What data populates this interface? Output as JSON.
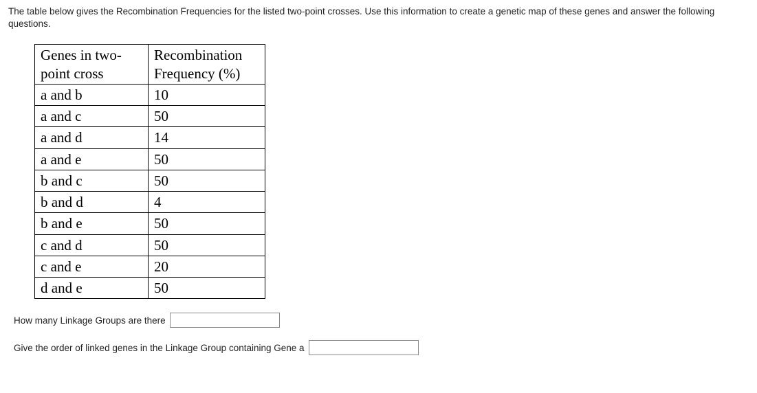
{
  "instructions": "The table below gives the Recombination Frequencies for the listed two-point crosses. Use this information to create a genetic map of these genes and answer the following questions.",
  "table": {
    "header": {
      "col1": "Genes in two-point cross",
      "col2": "Recombination Frequency (%)"
    },
    "rows": [
      {
        "genes": "a and b",
        "freq": "10"
      },
      {
        "genes": "a and c",
        "freq": "50"
      },
      {
        "genes": "a and d",
        "freq": "14"
      },
      {
        "genes": "a and e",
        "freq": "50"
      },
      {
        "genes": "b and c",
        "freq": "50"
      },
      {
        "genes": "b and d",
        "freq": "4"
      },
      {
        "genes": "b and e",
        "freq": "50"
      },
      {
        "genes": "c and d",
        "freq": "50"
      },
      {
        "genes": "c and e",
        "freq": "20"
      },
      {
        "genes": "d and e",
        "freq": "50"
      }
    ]
  },
  "questions": {
    "q1": "How many Linkage Groups are there",
    "q2": "Give the order of linked genes in the Linkage Group containing Gene a"
  }
}
